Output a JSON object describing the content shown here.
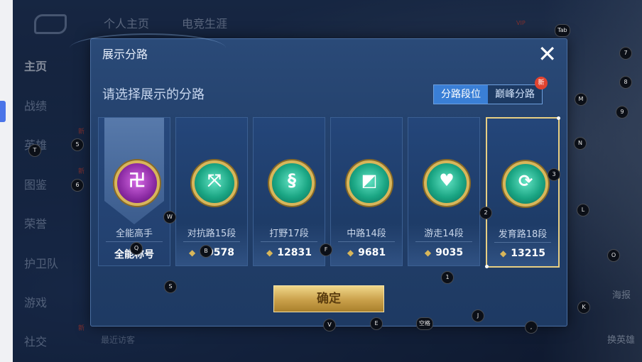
{
  "nav": {
    "top_tabs": [
      "个人主页",
      "电竞生涯"
    ],
    "side_items": [
      "主页",
      "战绩",
      "英雄",
      "图鉴",
      "荣誉",
      "护卫队",
      "游戏",
      "社交"
    ],
    "new_badges": [
      "新",
      "新",
      "新"
    ],
    "recent_visitors": "最近访客",
    "vip_label": "VIP",
    "right_labels": [
      "海报",
      "换英雄"
    ]
  },
  "dialog": {
    "title": "展示分路",
    "close_icon": "close-icon",
    "subtitle": "请选择展示的分路",
    "toggle": {
      "options": [
        "分路段位",
        "巅峰分路"
      ],
      "selected": "分路段位",
      "new_badge": "新"
    },
    "cards": [
      {
        "name": "全能高手",
        "value": "全能称号",
        "icon": "all-round-emblem-icon",
        "accent": "#8a2aa2"
      },
      {
        "name": "对抗路15段",
        "value": "10578",
        "icon": "clash-lane-emblem-icon",
        "accent": "#1aa583"
      },
      {
        "name": "打野17段",
        "value": "12831",
        "icon": "jungle-emblem-icon",
        "accent": "#1aa583"
      },
      {
        "name": "中路14段",
        "value": "9681",
        "icon": "mid-lane-emblem-icon",
        "accent": "#1aa583"
      },
      {
        "name": "游走14段",
        "value": "9035",
        "icon": "roam-emblem-icon",
        "accent": "#1aa583"
      },
      {
        "name": "发育路18段",
        "value": "13215",
        "icon": "farm-lane-emblem-icon",
        "accent": "#1aa583"
      }
    ],
    "selected_index": 5,
    "confirm_label": "确定"
  },
  "key_hints": [
    "Tab",
    "7",
    "8",
    "9",
    "M",
    "N",
    "3",
    "L",
    "O",
    "K",
    "T",
    "5",
    "6",
    "W",
    "2",
    "S",
    "1",
    "V",
    "E",
    "空格",
    "J",
    ",",
    "F",
    "B",
    "Q"
  ]
}
